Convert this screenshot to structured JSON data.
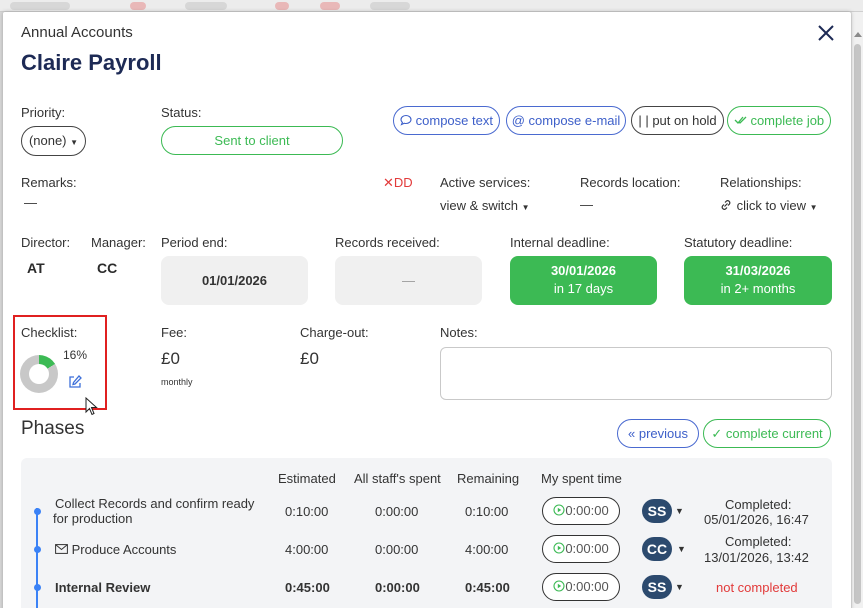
{
  "header": {
    "subtitle": "Annual Accounts",
    "title": "Claire Payroll"
  },
  "priority": {
    "label": "Priority:",
    "value": "(none)"
  },
  "status": {
    "label": "Status:",
    "value": "Sent to client"
  },
  "actions": {
    "compose_text": "compose text",
    "compose_email": "compose e-mail",
    "put_on_hold": "put on hold",
    "complete_job": "complete job"
  },
  "remarks": {
    "label": "Remarks:",
    "value": "—",
    "dd": "DD"
  },
  "active_services": {
    "label": "Active services:",
    "value": "view & switch"
  },
  "records_location": {
    "label": "Records location:",
    "value": "—"
  },
  "relationships": {
    "label": "Relationships:",
    "value": "click to view"
  },
  "director": {
    "label": "Director:",
    "value": "AT"
  },
  "manager": {
    "label": "Manager:",
    "value": "CC"
  },
  "period_end": {
    "label": "Period end:",
    "value": "01/01/2026"
  },
  "records_received": {
    "label": "Records received:",
    "value": "—"
  },
  "internal_deadline": {
    "label": "Internal deadline:",
    "date": "30/01/2026",
    "relative": "in 17 days"
  },
  "statutory_deadline": {
    "label": "Statutory deadline:",
    "date": "31/03/2026",
    "relative": "in 2+ months"
  },
  "checklist": {
    "label": "Checklist:",
    "percent_text": "16%",
    "progress": 0.16
  },
  "fee": {
    "label": "Fee:",
    "value": "£0",
    "period": "monthly"
  },
  "charge_out": {
    "label": "Charge-out:",
    "value": "£0"
  },
  "notes": {
    "label": "Notes:",
    "value": ""
  },
  "phases": {
    "title": "Phases",
    "previous": "previous",
    "complete_current": "complete current",
    "columns": [
      "Estimated",
      "All staff's spent",
      "Remaining",
      "My spent time"
    ],
    "rows": [
      {
        "name_line1": "Collect Records and confirm ready",
        "name_line2": "for production",
        "estimated": "0:10:00",
        "spent": "0:00:00",
        "remaining": "0:10:00",
        "my_time": "0:00:00",
        "assignee": "SS",
        "status_line1": "Completed:",
        "status_line2": "05/01/2026, 16:47"
      },
      {
        "name_line1": "Produce Accounts",
        "estimated": "4:00:00",
        "spent": "0:00:00",
        "remaining": "4:00:00",
        "my_time": "0:00:00",
        "assignee": "CC",
        "status_line1": "Completed:",
        "status_line2": "13/01/2026, 13:42"
      },
      {
        "name_line1": "Internal Review",
        "estimated": "0:45:00",
        "spent": "0:00:00",
        "remaining": "0:45:00",
        "my_time": "0:00:00",
        "assignee": "SS",
        "status_line1": "not completed"
      }
    ]
  },
  "colors": {
    "primary": "#1d2a55",
    "green": "#3cba54",
    "blue": "#3d5fc9",
    "red": "#e23a3a",
    "badge": "#2c4a6e"
  }
}
